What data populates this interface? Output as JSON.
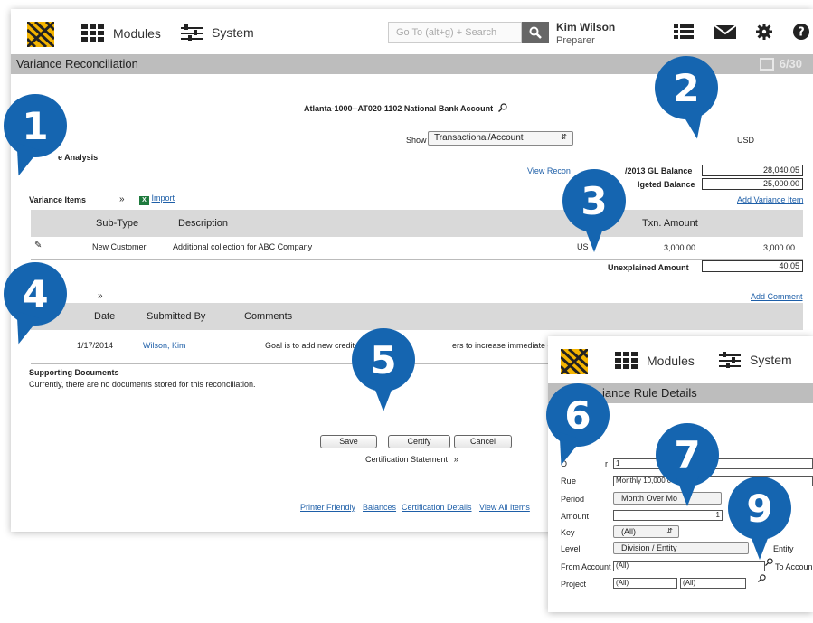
{
  "main": {
    "nav": {
      "modules": "Modules",
      "system": "System"
    },
    "search": {
      "placeholder": "Go To (alt+g) + Search"
    },
    "user": {
      "name": "Kim Wilson",
      "role": "Preparer"
    },
    "page_title": "Variance Reconciliation",
    "count": "6/30",
    "account_title": "Atlanta-1000--AT020-1102 National Bank Account",
    "show_label": "Show",
    "show_value": "Transactional/Account",
    "currency": "USD",
    "analysis_heading": "e Analysis",
    "view_link": "View Recon",
    "gl_balance_label": "/2013 GL Balance",
    "gl_balance_value": "28,040.05",
    "budgeted_label": "lgeted Balance",
    "budgeted_value": "25,000.00",
    "add_variance_item": "Add Variance Item",
    "variance_items_heading": "Variance Items",
    "import_label": "Import",
    "items_table": {
      "headers": [
        "Sub-Type",
        "Description",
        "Txn. Amount"
      ],
      "row": {
        "sub_type": "New Customer",
        "description": "Additional collection for ABC Company",
        "currency": "US",
        "txn_amount": "3,000.00",
        "amount": "3,000.00"
      }
    },
    "unexplained_label": "Unexplained Amount",
    "unexplained_value": "40.05",
    "add_comment": "Add Comment",
    "comments_table": {
      "headers": [
        "Date",
        "Submitted By",
        "Comments"
      ],
      "row": {
        "date": "1/17/2014",
        "submitted_by": "Wilson, Kim",
        "comment": "Goal is to add new credit ca",
        "comment_tail": "ers to increase immediate cash f"
      }
    },
    "supporting_heading": "Supporting Documents",
    "supporting_text": "Currently, there are no documents stored for this reconciliation.",
    "buttons": {
      "save": "Save",
      "certify": "Certify",
      "cancel": "Cancel"
    },
    "certification_statement": "Certification Statement",
    "footer_links": [
      "Printer Friendly",
      "Balances",
      "Certification Details",
      "View All Items"
    ]
  },
  "rule": {
    "nav": {
      "modules": "Modules",
      "system": "System"
    },
    "title": "iance Rule Details",
    "labels": {
      "order": "O",
      "order_tail": "r",
      "rule": "Ru",
      "rule_tail": "e",
      "period": "Period",
      "amount": "Amount",
      "key": "Key",
      "level": "Level",
      "from_account": "From Account",
      "to_account": "To Accoun",
      "project": "Project",
      "level_right": "Entity"
    },
    "values": {
      "order": "1",
      "rule": "Monthly 10,000 c",
      "period": "Month Over Mo",
      "amount": "1",
      "key": "(All)",
      "level": "Division / Entity",
      "from_account": "(All)",
      "project_a": "(All)",
      "project_b": "(All)"
    }
  },
  "markers": [
    "1",
    "2",
    "3",
    "4",
    "5",
    "6",
    "7",
    "9"
  ]
}
